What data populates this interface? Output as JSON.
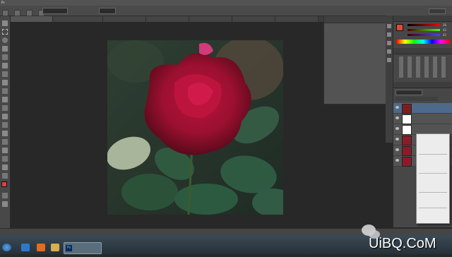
{
  "app": {
    "name": "Adobe Photoshop CS6",
    "menu_items": [
      "",
      "",
      "",
      "",
      "",
      "",
      "",
      "",
      "",
      "",
      ""
    ]
  },
  "options_bar": {
    "zoom_field": "",
    "mode_field": ""
  },
  "document": {
    "tab_label": ""
  },
  "floating_panel": {
    "title": ""
  },
  "color_panel": {
    "tab": "",
    "r_value": "26",
    "g_value": "42",
    "b_value": "42"
  },
  "layers_panel": {
    "tab": "",
    "blend_mode": "",
    "opacity_label": "",
    "layers": [
      {
        "name": "",
        "visible": true,
        "thumb_color": "#7a1f1f"
      },
      {
        "name": "",
        "visible": true,
        "thumb_color": "#ffffff"
      },
      {
        "name": "",
        "visible": true,
        "thumb_color": "#ffffff"
      },
      {
        "name": "",
        "visible": true,
        "thumb_color": "#8a1c2a"
      },
      {
        "name": "",
        "visible": true,
        "thumb_color": "#8a1c2a"
      },
      {
        "name": "",
        "visible": true,
        "thumb_color": "#8a1c2a"
      }
    ]
  },
  "context_menu": {
    "items": [
      "",
      "",
      "",
      "",
      "",
      "",
      "",
      "",
      "",
      "",
      "",
      "",
      "",
      "",
      "",
      "",
      "",
      "",
      "",
      "",
      "",
      "",
      ""
    ]
  },
  "status_bar": {
    "zoom": "",
    "doc_info": ""
  },
  "taskbar": {
    "start": "",
    "ps_window_label": "",
    "icons": [
      "start-orb",
      "ie-icon",
      "media-icon",
      "explorer-icon",
      "ps-icon"
    ]
  },
  "watermark": {
    "line1": "",
    "line2": "UiBQ.CoM"
  },
  "colors": {
    "bg": "#282828",
    "panel": "#535353",
    "accent": "#2f7bd0",
    "rose": "#9c1030"
  }
}
